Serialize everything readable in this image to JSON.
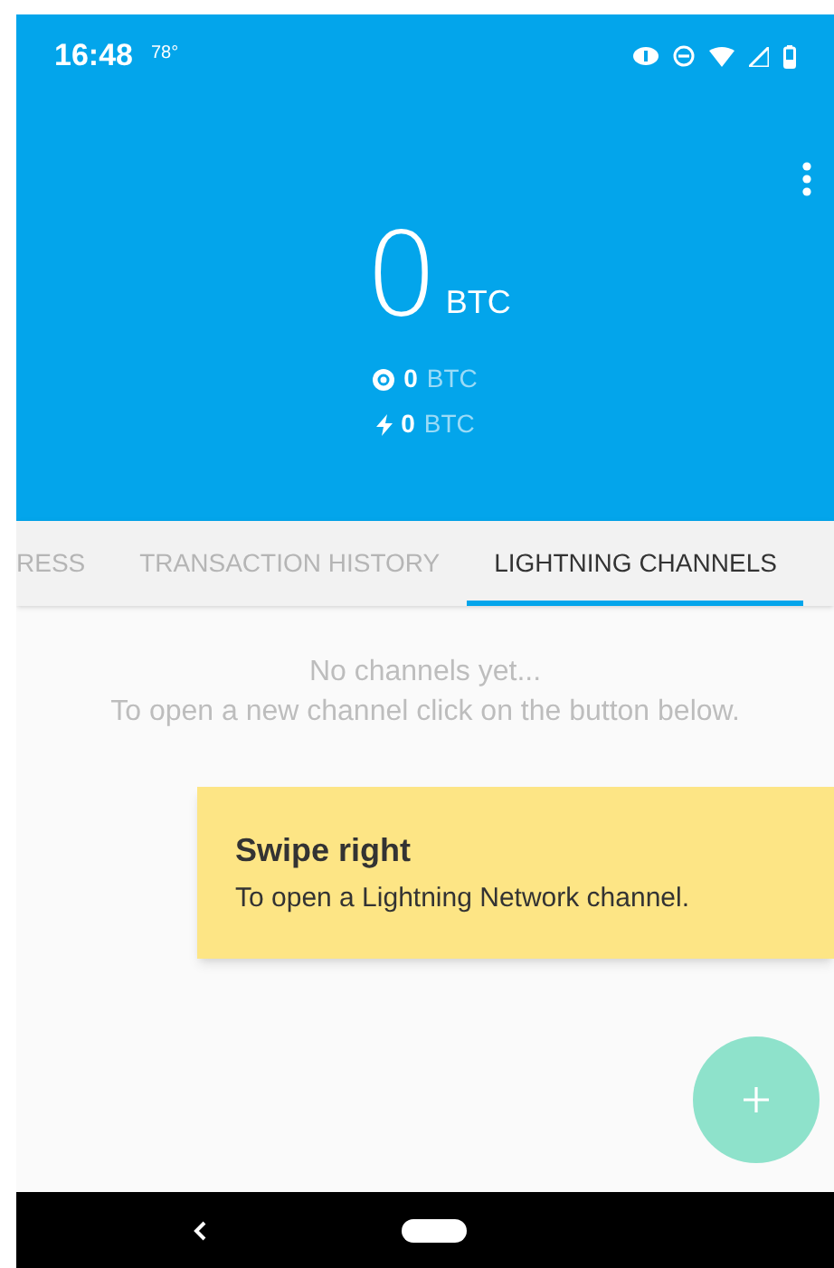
{
  "status_bar": {
    "time": "16:48",
    "temperature": "78°"
  },
  "balance": {
    "amount": "0",
    "unit": "BTC",
    "rows": [
      {
        "kind": "onchain",
        "amount": "0",
        "unit": "BTC"
      },
      {
        "kind": "lightning",
        "amount": "0",
        "unit": "BTC"
      }
    ]
  },
  "tabs": [
    {
      "label": "RESS",
      "selected": false
    },
    {
      "label": "TRANSACTION HISTORY",
      "selected": false
    },
    {
      "label": "LIGHTNING CHANNELS",
      "selected": true
    }
  ],
  "empty_state": {
    "title": "No channels yet...",
    "message": "To open a new channel click on the button below."
  },
  "hint_card": {
    "title": "Swipe right",
    "message": "To open a Lightning Network channel."
  }
}
